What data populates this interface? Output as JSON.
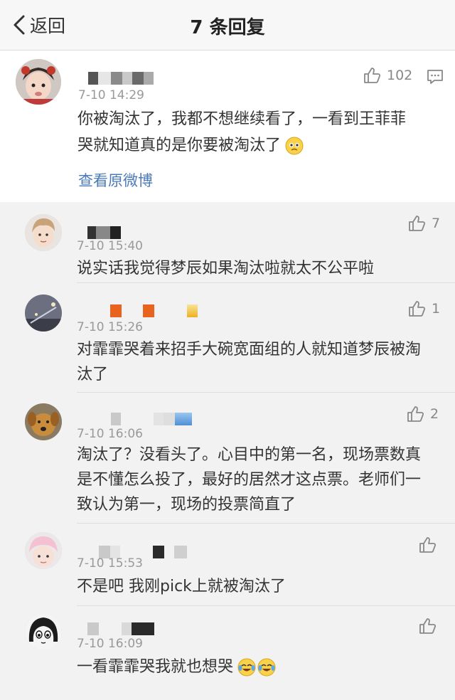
{
  "nav": {
    "back_label": "返回",
    "title": "7 条回复"
  },
  "main_comment": {
    "avatar_icon": "baby-avatar-icon",
    "time": "7-10 14:29",
    "like_count": "102",
    "text_line1": "你被淘汰了，我都不想继续看了，一看到王菲菲",
    "text_line2": "哭就知道真的是你要被淘汰了",
    "emoji_icon": "pleading-face-emoji",
    "view_original_label": "查看原微博"
  },
  "replies": [
    {
      "time": "7-10 15:40",
      "like_count": "7",
      "lines": [
        "说实话我觉得梦辰如果淘汰啦就太不公平啦"
      ],
      "avatar_icon": "young-man-avatar-icon"
    },
    {
      "time": "7-10 15:26",
      "like_count": "1",
      "lines": [
        "对霏霏哭着来招手大碗宽面组的人就知道梦辰被淘",
        "汰了"
      ],
      "avatar_icon": "night-street-avatar-icon"
    },
    {
      "time": "7-10 16:06",
      "like_count": "2",
      "lines": [
        "淘汰了？没看头了。心目中的第一名，现场票数真",
        "是不懂怎么投了，最好的居然才这点票。老师们一",
        "致认为第一，现场的投票简直了"
      ],
      "avatar_icon": "dog-avatar-icon"
    },
    {
      "time": "7-10 15:53",
      "like_count": "",
      "lines": [
        "不是吧 我刚pick上就被淘汰了"
      ],
      "avatar_icon": "pink-hat-avatar-icon"
    },
    {
      "time": "7-10 16:09",
      "like_count": "",
      "lines": [
        "一看霏霏哭我就也想哭"
      ],
      "avatar_icon": "manga-girl-avatar-icon",
      "emoji_icons": [
        "crying-laughing-emoji",
        "crying-laughing-emoji"
      ]
    }
  ],
  "colors": {
    "link": "#4a7bb8",
    "meta": "#999999",
    "background": "#f2f2f2"
  }
}
